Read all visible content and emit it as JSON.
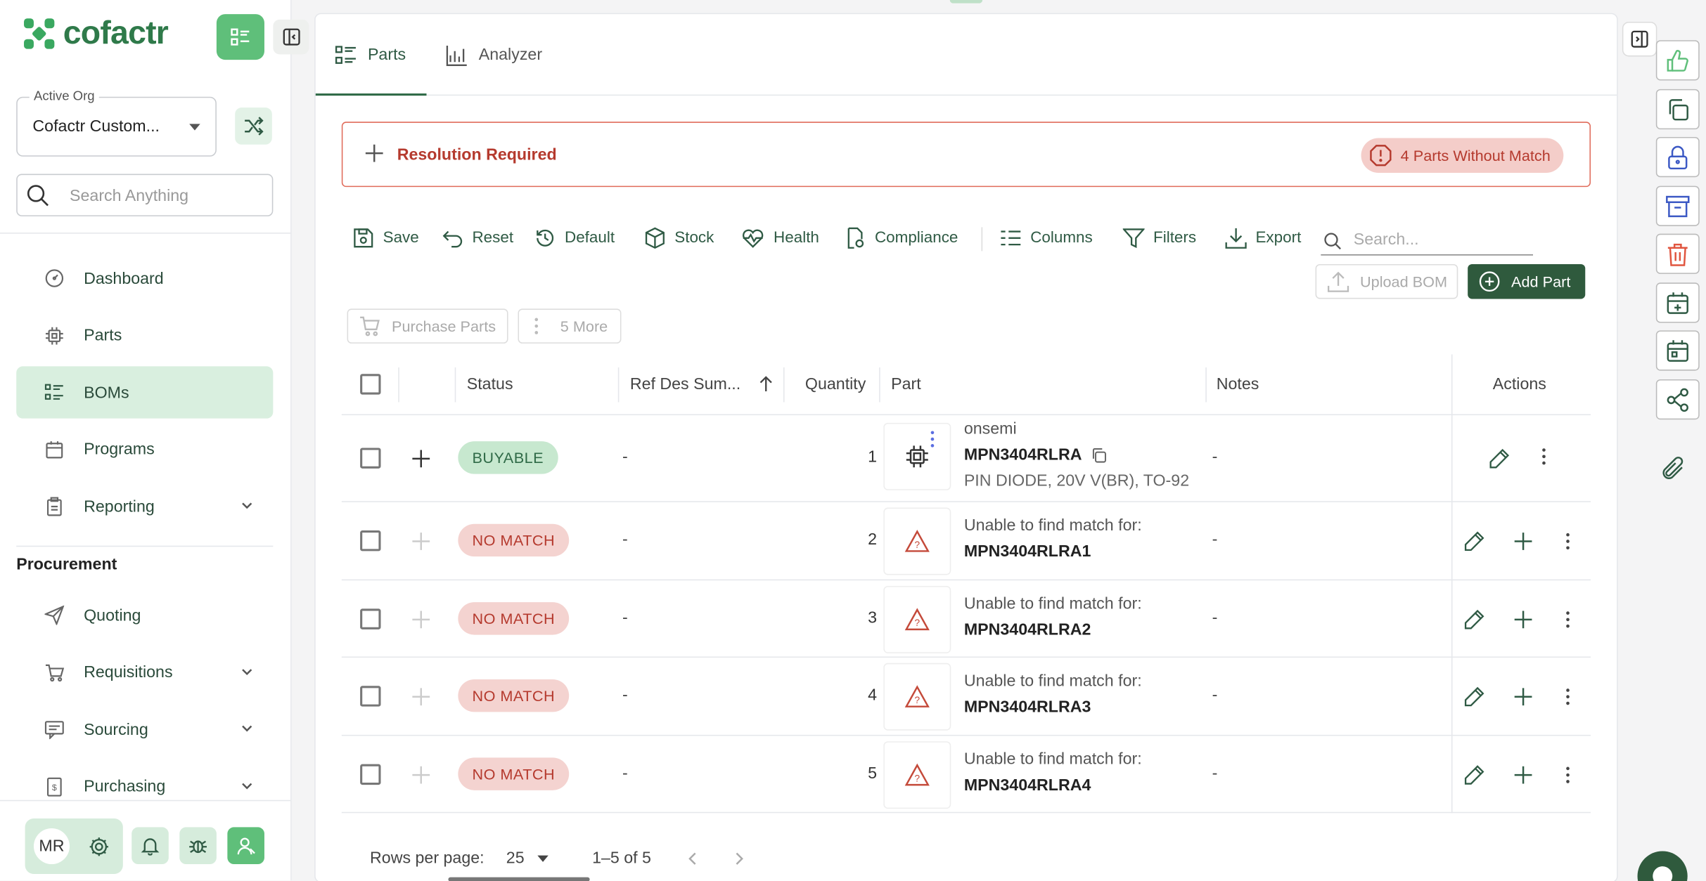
{
  "app": {
    "name": "cofactr"
  },
  "org": {
    "label": "Active Org",
    "value": "Cofactr Custom..."
  },
  "search": {
    "placeholder": "Search Anything"
  },
  "nav": [
    {
      "label": "Dashboard",
      "icon": "dashboard-icon"
    },
    {
      "label": "Parts",
      "icon": "chip-icon"
    },
    {
      "label": "BOMs",
      "icon": "list-icon",
      "active": true
    },
    {
      "label": "Programs",
      "icon": "calendar-icon"
    },
    {
      "label": "Reporting",
      "icon": "clipboard-icon",
      "expandable": true
    }
  ],
  "procurement": {
    "title": "Procurement",
    "items": [
      {
        "label": "Quoting",
        "icon": "send-icon"
      },
      {
        "label": "Requisitions",
        "icon": "cart-icon",
        "expandable": true
      },
      {
        "label": "Sourcing",
        "icon": "chat-icon",
        "expandable": true
      },
      {
        "label": "Purchasing",
        "icon": "invoice-icon",
        "expandable": true
      }
    ]
  },
  "user": {
    "initials": "MR"
  },
  "tabs": [
    {
      "label": "Parts",
      "active": true
    },
    {
      "label": "Analyzer"
    }
  ],
  "alert": {
    "title": "Resolution Required",
    "badge": "4 Parts Without Match"
  },
  "toolbar": {
    "save": "Save",
    "reset": "Reset",
    "default": "Default",
    "stock": "Stock",
    "health": "Health",
    "compliance": "Compliance",
    "columns": "Columns",
    "filters": "Filters",
    "export": "Export",
    "search_placeholder": "Search...",
    "upload_bom": "Upload BOM",
    "add_part": "Add Part",
    "purchase_parts": "Purchase Parts",
    "more": "5 More"
  },
  "table": {
    "columns": {
      "status": "Status",
      "refdes": "Ref Des Sum...",
      "quantity": "Quantity",
      "part": "Part",
      "notes": "Notes",
      "actions": "Actions"
    },
    "rows": [
      {
        "status": "BUYABLE",
        "refdes": "-",
        "qty": "1",
        "mfr": "onsemi",
        "mpn": "MPN3404RLRA",
        "desc": "PIN DIODE, 20V V(BR), TO-92",
        "notes": "-"
      },
      {
        "status": "NO MATCH",
        "refdes": "-",
        "qty": "2",
        "line1": "Unable to find match for:",
        "line2": "MPN3404RLRA1",
        "notes": "-"
      },
      {
        "status": "NO MATCH",
        "refdes": "-",
        "qty": "3",
        "line1": "Unable to find match for:",
        "line2": "MPN3404RLRA2",
        "notes": "-"
      },
      {
        "status": "NO MATCH",
        "refdes": "-",
        "qty": "4",
        "line1": "Unable to find match for:",
        "line2": "MPN3404RLRA3",
        "notes": "-"
      },
      {
        "status": "NO MATCH",
        "refdes": "-",
        "qty": "5",
        "line1": "Unable to find match for:",
        "line2": "MPN3404RLRA4",
        "notes": "-"
      }
    ]
  },
  "pagination": {
    "rows_label": "Rows per page:",
    "rows_value": "25",
    "range": "1–5 of 5"
  },
  "colors": {
    "brand": "#2f7a4a",
    "accent": "#5fbf7a",
    "danger": "#b53a2e"
  }
}
